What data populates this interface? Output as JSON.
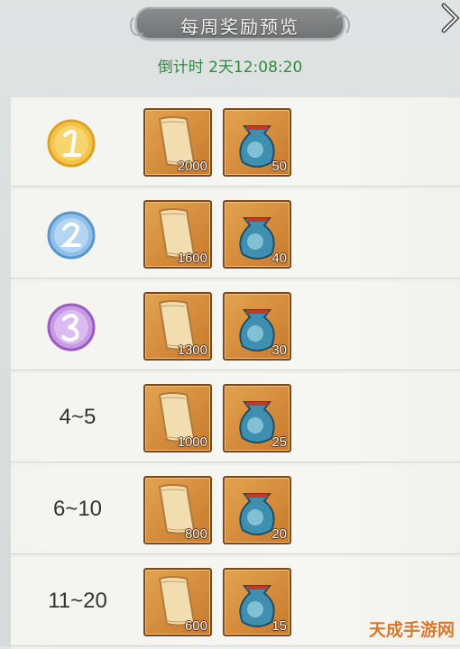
{
  "header": {
    "title": "每周奖励预览",
    "countdown": "倒计时 2天12:08:20"
  },
  "rows": [
    {
      "rank_type": "medal",
      "medal_color": "gold",
      "rank": "1",
      "items": [
        {
          "icon": "scroll-icon",
          "count": "2000"
        },
        {
          "icon": "pouch-icon",
          "count": "50"
        }
      ]
    },
    {
      "rank_type": "medal",
      "medal_color": "blue",
      "rank": "2",
      "items": [
        {
          "icon": "scroll-icon",
          "count": "1600"
        },
        {
          "icon": "pouch-icon",
          "count": "40"
        }
      ]
    },
    {
      "rank_type": "medal",
      "medal_color": "purple",
      "rank": "3",
      "items": [
        {
          "icon": "scroll-icon",
          "count": "1300"
        },
        {
          "icon": "pouch-icon",
          "count": "30"
        }
      ]
    },
    {
      "rank_type": "text",
      "rank": "4~5",
      "items": [
        {
          "icon": "scroll-icon",
          "count": "1000"
        },
        {
          "icon": "pouch-icon",
          "count": "25"
        }
      ]
    },
    {
      "rank_type": "text",
      "rank": "6~10",
      "items": [
        {
          "icon": "scroll-icon",
          "count": "800"
        },
        {
          "icon": "pouch-icon",
          "count": "20"
        }
      ]
    },
    {
      "rank_type": "text",
      "rank": "11~20",
      "items": [
        {
          "icon": "scroll-icon",
          "count": "600"
        },
        {
          "icon": "pouch-icon",
          "count": "15"
        }
      ]
    }
  ],
  "watermark": "天成手游网",
  "colors": {
    "countdown": "#2f8a3b",
    "item_bg": "#d98f3e",
    "gold": "#e6a21e",
    "blue": "#4d8bc9",
    "purple": "#9a5cc4"
  }
}
